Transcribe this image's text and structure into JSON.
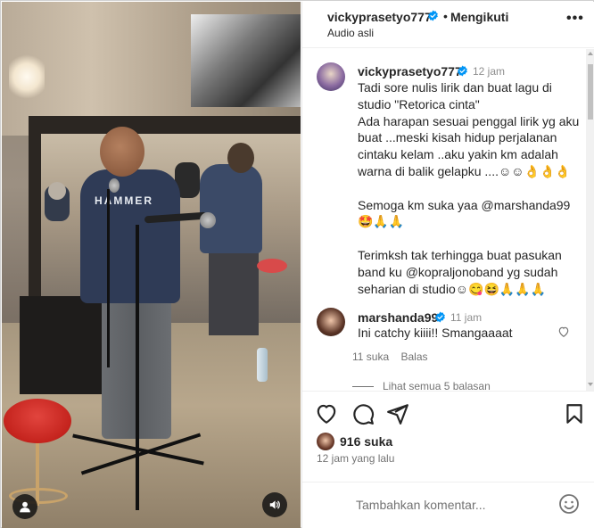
{
  "post": {
    "username": "vickyprasetyo777",
    "follow_status": "Mengikuti",
    "audio_label": "Audio asli",
    "separator": "•",
    "more_label": "•••"
  },
  "media": {
    "shirt_text": "HAMMER",
    "user_tag_icon": "user-icon",
    "audio_icon": "speaker-icon"
  },
  "caption": {
    "username": "vickyprasetyo777",
    "time": "12 jam",
    "text": "Tadi sore nulis lirik dan buat lagu di studio \"Retorica cinta\"\nAda harapan sesuai penggal lirik yg aku buat ...meski kisah hidup perjalanan cintaku kelam ..aku yakin km adalah warna di balik gelapku ....☺☺👌👌👌\n\nSemoga km suka yaa @marshanda99 🤩🙏🙏\n\nTerimksh tak terhingga buat pasukan band ku @kopraljonoband yg sudah seharian di studio☺😋😆🙏🙏🙏"
  },
  "comment": {
    "username": "marshanda99",
    "time": "11 jam",
    "text": "Ini catchy kiiii!! Smangaaaat",
    "likes": "11 suka",
    "reply_label": "Balas",
    "view_replies": "Lihat semua 5 balasan"
  },
  "actions": {
    "likes_count": "916 suka",
    "posted_time": "12 jam yang lalu"
  },
  "composer": {
    "placeholder": "Tambahkan komentar..."
  },
  "colors": {
    "verified": "#0095f6",
    "text": "#262626",
    "muted": "#737373"
  }
}
